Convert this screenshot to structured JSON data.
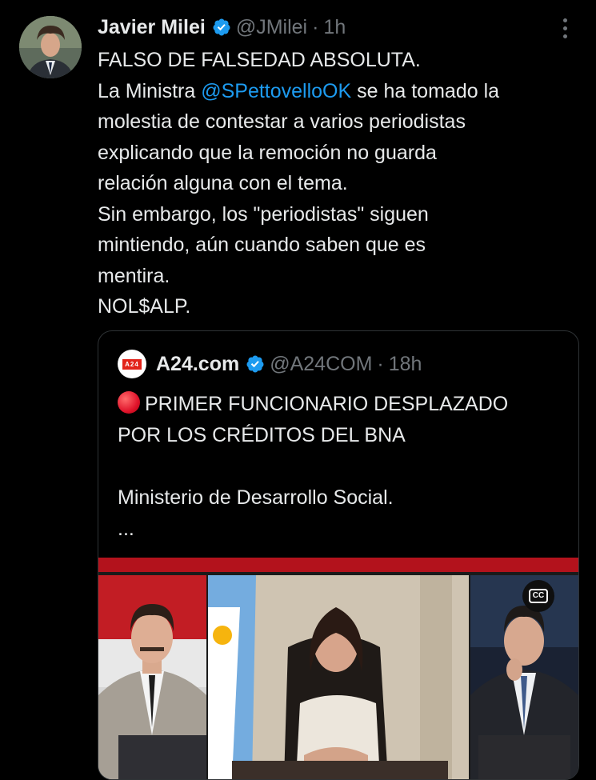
{
  "tweet": {
    "author_name": "Javier Milei",
    "handle": "@JMilei",
    "separator": "·",
    "time": "1h",
    "lines": [
      {
        "text": "FALSO DE FALSEDAD ABSOLUTA."
      },
      {
        "before": "La Ministra ",
        "mention": "@SPettovelloOK",
        "after": " se ha tomado la"
      },
      {
        "text": "molestia de contestar a varios periodistas"
      },
      {
        "text": "explicando que la remoción no guarda"
      },
      {
        "text": "relación alguna con el tema."
      },
      {
        "text": "Sin embargo, los \"periodistas\" siguen"
      },
      {
        "text": "mintiendo, aún cuando saben que es"
      },
      {
        "text": "mentira."
      },
      {
        "text": "NOL$ALP."
      }
    ]
  },
  "quoted": {
    "logo_text": "A24",
    "author_name": "A24.com",
    "handle": "@A24COM",
    "separator": "·",
    "time": "18h",
    "lines": [
      "PRIMER FUNCIONARIO DESPLAZADO",
      "POR LOS CRÉDITOS DEL BNA",
      "",
      "Ministerio de Desarrollo Social.",
      "..."
    ],
    "cc_label": "CC"
  },
  "colors": {
    "background": "#000000",
    "text": "#e7e9ea",
    "secondary": "#71767b",
    "link": "#1d9bf0",
    "verified": "#1d9bf0",
    "brand_red": "#e2231a"
  },
  "icons": [
    "verified-badge-icon",
    "more-options-icon",
    "red-circle-emoji-icon",
    "closed-captions-icon"
  ]
}
